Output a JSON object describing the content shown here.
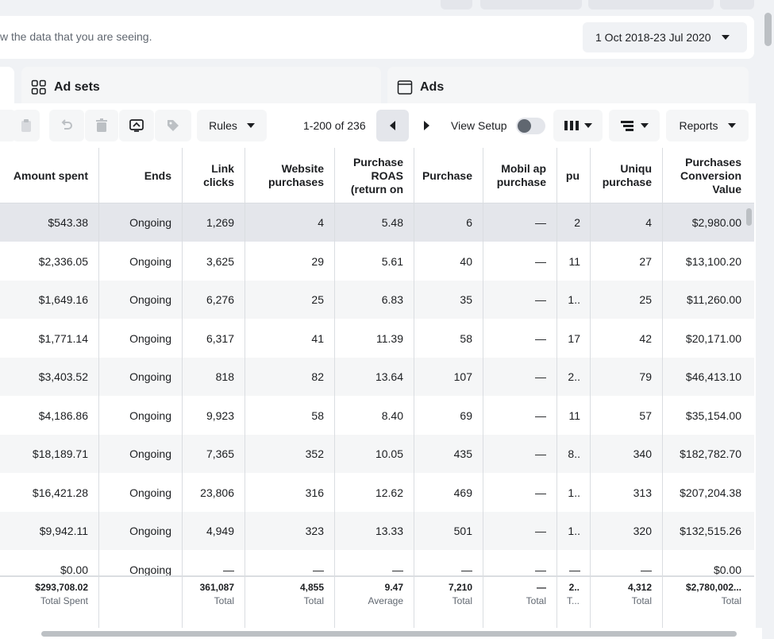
{
  "info": {
    "text": "w the data that you are seeing."
  },
  "date_range": {
    "label": "1 Oct 2018-23 Jul 2020"
  },
  "tabs": [
    {
      "label": "Ad sets",
      "icon": "grid-icon"
    },
    {
      "label": "Ads",
      "icon": "window-icon"
    }
  ],
  "toolbar": {
    "rules_label": "Rules",
    "pagination": "1-200 of 236",
    "view_setup_label": "View Setup",
    "reports_label": "Reports"
  },
  "table": {
    "headers": [
      "Amount spent",
      "Ends",
      "Link clicks",
      "Website purchases",
      "Purchase ROAS (return on",
      "Purchase",
      "Mobil ap purchase",
      "pu",
      "Uniqu purchase",
      "Purchases Conversion Value"
    ],
    "rows": [
      [
        "$543.38",
        "Ongoing",
        "1,269",
        "4",
        "5.48",
        "6",
        "—",
        "2",
        "4",
        "$2,980.00"
      ],
      [
        "$2,336.05",
        "Ongoing",
        "3,625",
        "29",
        "5.61",
        "40",
        "—",
        "11",
        "27",
        "$13,100.20"
      ],
      [
        "$1,649.16",
        "Ongoing",
        "6,276",
        "25",
        "6.83",
        "35",
        "—",
        "1..",
        "25",
        "$11,260.00"
      ],
      [
        "$1,771.14",
        "Ongoing",
        "6,317",
        "41",
        "11.39",
        "58",
        "—",
        "17",
        "42",
        "$20,171.00"
      ],
      [
        "$3,403.52",
        "Ongoing",
        "818",
        "82",
        "13.64",
        "107",
        "—",
        "2..",
        "79",
        "$46,413.10"
      ],
      [
        "$4,186.86",
        "Ongoing",
        "9,923",
        "58",
        "8.40",
        "69",
        "—",
        "11",
        "57",
        "$35,154.00"
      ],
      [
        "$18,189.71",
        "Ongoing",
        "7,365",
        "352",
        "10.05",
        "435",
        "—",
        "8..",
        "340",
        "$182,782.70"
      ],
      [
        "$16,421.28",
        "Ongoing",
        "23,806",
        "316",
        "12.62",
        "469",
        "—",
        "1..",
        "313",
        "$207,204.38"
      ],
      [
        "$9,942.11",
        "Ongoing",
        "4,949",
        "323",
        "13.33",
        "501",
        "—",
        "1..",
        "320",
        "$132,515.26"
      ],
      [
        "$0.00",
        "Ongoing",
        "—",
        "—",
        "—",
        "—",
        "—",
        "—",
        "—",
        "$0.00"
      ]
    ],
    "totals": [
      {
        "value": "$293,708.02",
        "label": "Total Spent"
      },
      {
        "value": "",
        "label": ""
      },
      {
        "value": "361,087",
        "label": "Total"
      },
      {
        "value": "4,855",
        "label": "Total"
      },
      {
        "value": "9.47",
        "label": "Average"
      },
      {
        "value": "7,210",
        "label": "Total"
      },
      {
        "value": "—",
        "label": "Total"
      },
      {
        "value": "2..",
        "label": "T..."
      },
      {
        "value": "4,312",
        "label": "Total"
      },
      {
        "value": "$2,780,002...",
        "label": "Total"
      }
    ]
  }
}
